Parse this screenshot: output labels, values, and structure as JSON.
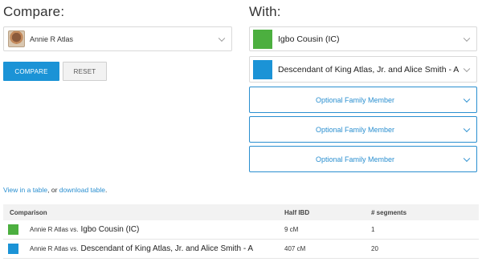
{
  "compare_heading": "Compare:",
  "with_heading": "With:",
  "compare_select": {
    "value": "Annie R Atlas"
  },
  "buttons": {
    "compare": "COMPARE",
    "reset": "RESET"
  },
  "with_options": [
    {
      "label": "Igbo Cousin (IC)",
      "color": "#4caf3f"
    },
    {
      "label": "Descendant of King Atlas, Jr. and Alice Smith - A",
      "color": "#1b93d6"
    },
    {
      "label": "Optional Family Member"
    },
    {
      "label": "Optional Family Member"
    },
    {
      "label": "Optional Family Member"
    }
  ],
  "links": {
    "table_link": "View in a table",
    "separator": ", or ",
    "download_link": "download table",
    "end": "."
  },
  "table": {
    "headers": [
      "Comparison",
      "Half IBD",
      "# segments"
    ],
    "rows": [
      {
        "color": "#4caf3f",
        "person": "Annie R Atlas",
        "vs": "vs.",
        "other": "Igbo Cousin (IC)",
        "half_ibd": "9 cM",
        "segments": "1"
      },
      {
        "color": "#1b93d6",
        "person": "Annie R Atlas",
        "vs": "vs.",
        "other": "Descendant of King Atlas, Jr. and Alice Smith - A",
        "half_ibd": "407 cM",
        "segments": "20"
      }
    ]
  }
}
